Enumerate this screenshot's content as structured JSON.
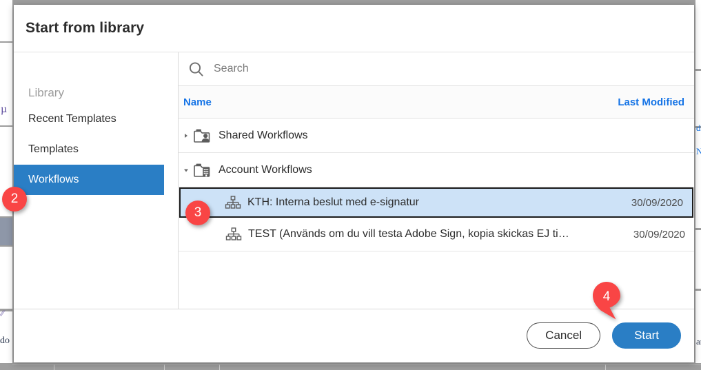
{
  "dialog": {
    "title": "Start from library"
  },
  "sidebar": {
    "heading": "Library",
    "items": [
      {
        "label": "Recent Templates",
        "selected": false
      },
      {
        "label": "Templates",
        "selected": false
      },
      {
        "label": "Workflows",
        "selected": true
      }
    ]
  },
  "search": {
    "placeholder": "Search",
    "value": "",
    "icon": "search-icon"
  },
  "table": {
    "columns": [
      {
        "key": "name",
        "label": "Name"
      },
      {
        "key": "last_modified",
        "label": "Last Modified"
      }
    ],
    "rows": [
      {
        "label": "Shared Workflows",
        "type": "folder",
        "icon": "folder-user-icon",
        "twisty": "chevron-right-icon",
        "expanded": false,
        "date": "",
        "selected": false
      },
      {
        "label": "Account Workflows",
        "type": "folder",
        "icon": "folder-building-icon",
        "twisty": "chevron-down-icon",
        "expanded": true,
        "date": "",
        "selected": false
      },
      {
        "label": "KTH: Interna beslut med e-signatur",
        "type": "workflow",
        "icon": "workflow-hierarchy-icon",
        "date": "30/09/2020",
        "selected": true
      },
      {
        "label": "TEST (Används om du vill testa Adobe Sign, kopia skickas EJ ti…",
        "type": "workflow",
        "icon": "workflow-hierarchy-icon",
        "date": "30/09/2020",
        "selected": false
      }
    ]
  },
  "footer": {
    "cancel_label": "Cancel",
    "start_label": "Start"
  },
  "markers": [
    {
      "id": "2",
      "label": "2",
      "target": "sidebar-item-workflows"
    },
    {
      "id": "3",
      "label": "3",
      "target": "workflow-row-selected"
    },
    {
      "id": "4",
      "label": "4",
      "target": "start-button"
    }
  ],
  "colors": {
    "accent_blue": "#2a7ec5",
    "link_blue": "#1473e6",
    "marker_red": "#f94545",
    "selected_row": "#cde2f7",
    "backdrop_gray": "#9e9e9e"
  }
}
